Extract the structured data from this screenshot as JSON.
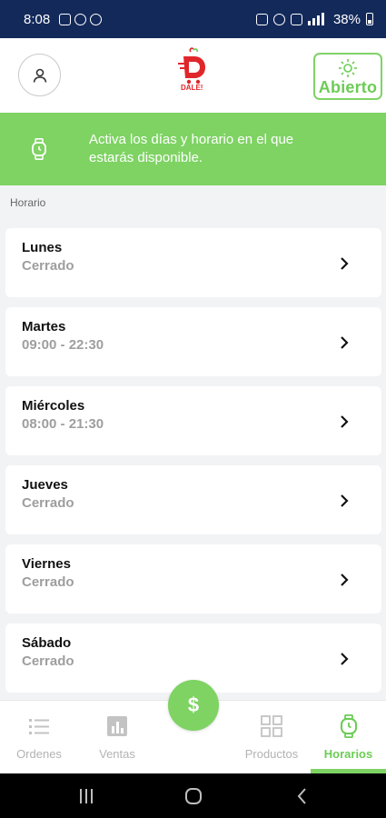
{
  "status_bar": {
    "time": "8:08",
    "battery": "38%"
  },
  "header": {
    "logo_text": "DALE!",
    "status_button_label": "Abierto"
  },
  "banner": {
    "text": "Activa los días y horario en el que estarás disponible."
  },
  "section": {
    "title": "Horario"
  },
  "schedule": [
    {
      "day": "Lunes",
      "hours": "Cerrado"
    },
    {
      "day": "Martes",
      "hours": "09:00 - 22:30"
    },
    {
      "day": "Miércoles",
      "hours": "08:00 - 21:30"
    },
    {
      "day": "Jueves",
      "hours": "Cerrado"
    },
    {
      "day": "Viernes",
      "hours": "Cerrado"
    },
    {
      "day": "Sábado",
      "hours": "Cerrado"
    }
  ],
  "nav": {
    "orders_label": "Ordenes",
    "sales_label": "Ventas",
    "fab_label": "$",
    "products_label": "Productos",
    "schedule_label": "Horarios",
    "active": "Horarios"
  },
  "colors": {
    "accent": "#7ed363",
    "status_bar": "#13295a",
    "logo_red": "#e0262b"
  },
  "icons": [
    "user-icon",
    "logo-icon",
    "sun-icon",
    "watch-icon",
    "chevron-right-icon",
    "list-icon",
    "bar-chart-icon",
    "grid-icon",
    "dollar-icon"
  ]
}
